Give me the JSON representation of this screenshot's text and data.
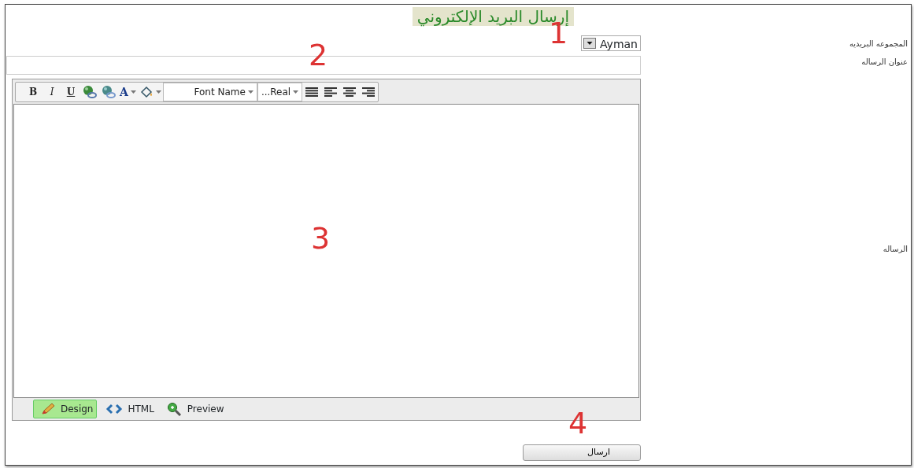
{
  "title": "إرسال البريد الإلكتروني",
  "fields": [
    {
      "kind": "select",
      "label": "المجموعه البريديه",
      "value": "Ayman"
    },
    {
      "kind": "text",
      "label": "عنوان الرساله"
    },
    {
      "kind": "editor",
      "label": "الرساله"
    }
  ],
  "toolbar": [
    {
      "kind": "icon"
    },
    {
      "kind": "icon"
    },
    {
      "kind": "icon"
    },
    {
      "kind": "icon"
    },
    {
      "kind": "dropdown",
      "label": "...Real"
    },
    {
      "kind": "dropdown",
      "label": "Font Name"
    },
    {
      "kind": "menu"
    },
    {
      "kind": "color",
      "label": "A"
    },
    {
      "kind": "icon"
    },
    {
      "kind": "icon"
    },
    {
      "kind": "format",
      "label": "U"
    },
    {
      "kind": "format",
      "label": "I"
    },
    {
      "kind": "format",
      "label": "B"
    }
  ],
  "modes": [
    {
      "label": "Preview",
      "selected": false
    },
    {
      "label": "HTML",
      "selected": false
    },
    {
      "label": "Design",
      "selected": true
    }
  ],
  "send_button": "ارسال",
  "annotations": [
    "1",
    "2",
    "3",
    "4"
  ]
}
